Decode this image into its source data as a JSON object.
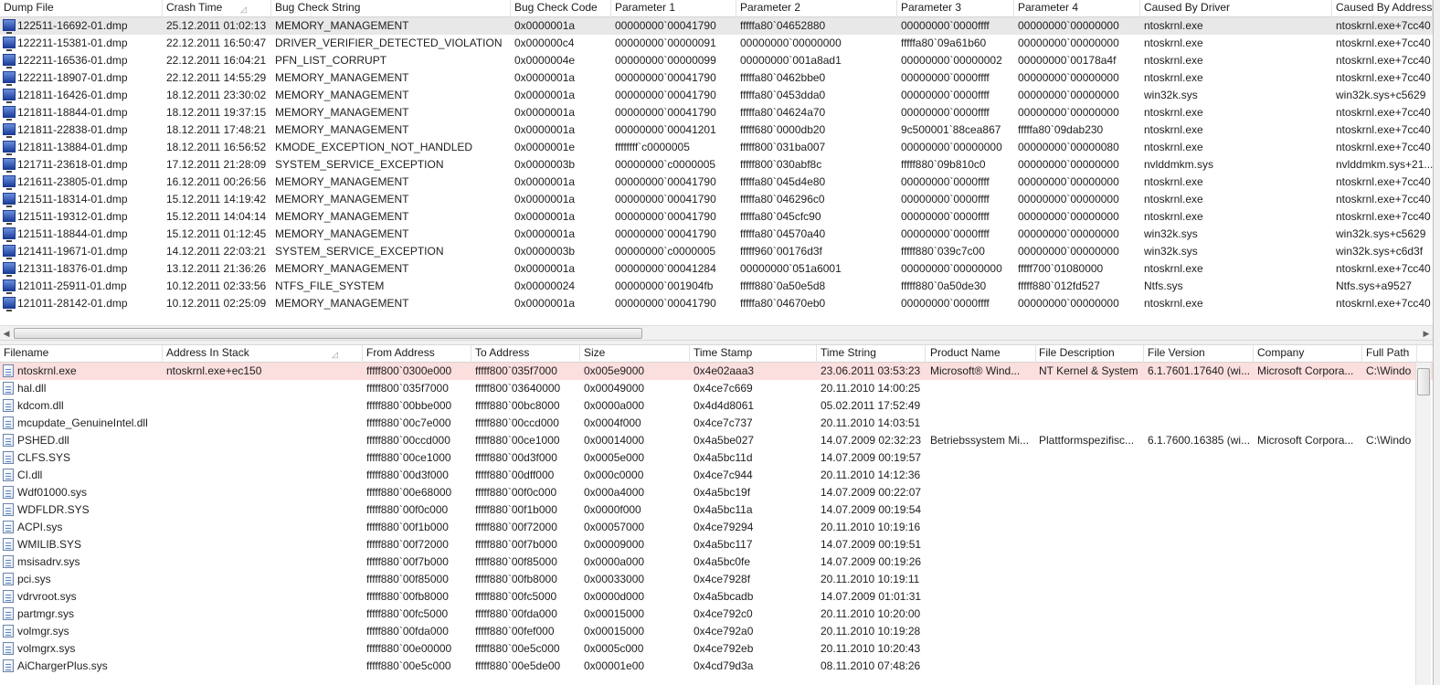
{
  "top_table": {
    "columns": [
      {
        "label": "Dump File"
      },
      {
        "label": "Crash Time",
        "sorted": true
      },
      {
        "label": "Bug Check String"
      },
      {
        "label": "Bug Check Code"
      },
      {
        "label": "Parameter 1"
      },
      {
        "label": "Parameter 2"
      },
      {
        "label": "Parameter 3"
      },
      {
        "label": "Parameter 4"
      },
      {
        "label": "Caused By Driver"
      },
      {
        "label": "Caused By Address"
      }
    ],
    "rows": [
      [
        "122511-16692-01.dmp",
        "25.12.2011 01:02:13",
        "MEMORY_MANAGEMENT",
        "0x0000001a",
        "00000000`00041790",
        "fffffa80`04652880",
        "00000000`0000ffff",
        "00000000`00000000",
        "ntoskrnl.exe",
        "ntoskrnl.exe+7cc40"
      ],
      [
        "122211-15381-01.dmp",
        "22.12.2011 16:50:47",
        "DRIVER_VERIFIER_DETECTED_VIOLATION",
        "0x000000c4",
        "00000000`00000091",
        "00000000`00000000",
        "fffffa80`09a61b60",
        "00000000`00000000",
        "ntoskrnl.exe",
        "ntoskrnl.exe+7cc40"
      ],
      [
        "122211-16536-01.dmp",
        "22.12.2011 16:04:21",
        "PFN_LIST_CORRUPT",
        "0x0000004e",
        "00000000`00000099",
        "00000000`001a8ad1",
        "00000000`00000002",
        "00000000`00178a4f",
        "ntoskrnl.exe",
        "ntoskrnl.exe+7cc40"
      ],
      [
        "122211-18907-01.dmp",
        "22.12.2011 14:55:29",
        "MEMORY_MANAGEMENT",
        "0x0000001a",
        "00000000`00041790",
        "fffffa80`0462bbe0",
        "00000000`0000ffff",
        "00000000`00000000",
        "ntoskrnl.exe",
        "ntoskrnl.exe+7cc40"
      ],
      [
        "121811-16426-01.dmp",
        "18.12.2011 23:30:02",
        "MEMORY_MANAGEMENT",
        "0x0000001a",
        "00000000`00041790",
        "fffffa80`0453dda0",
        "00000000`0000ffff",
        "00000000`00000000",
        "win32k.sys",
        "win32k.sys+c5629"
      ],
      [
        "121811-18844-01.dmp",
        "18.12.2011 19:37:15",
        "MEMORY_MANAGEMENT",
        "0x0000001a",
        "00000000`00041790",
        "fffffa80`04624a70",
        "00000000`0000ffff",
        "00000000`00000000",
        "ntoskrnl.exe",
        "ntoskrnl.exe+7cc40"
      ],
      [
        "121811-22838-01.dmp",
        "18.12.2011 17:48:21",
        "MEMORY_MANAGEMENT",
        "0x0000001a",
        "00000000`00041201",
        "fffff680`0000db20",
        "9c500001`88cea867",
        "fffffa80`09dab230",
        "ntoskrnl.exe",
        "ntoskrnl.exe+7cc40"
      ],
      [
        "121811-13884-01.dmp",
        "18.12.2011 16:56:52",
        "KMODE_EXCEPTION_NOT_HANDLED",
        "0x0000001e",
        "ffffffff`c0000005",
        "fffff800`031ba007",
        "00000000`00000000",
        "00000000`00000080",
        "ntoskrnl.exe",
        "ntoskrnl.exe+7cc40"
      ],
      [
        "121711-23618-01.dmp",
        "17.12.2011 21:28:09",
        "SYSTEM_SERVICE_EXCEPTION",
        "0x0000003b",
        "00000000`c0000005",
        "fffff800`030abf8c",
        "fffff880`09b810c0",
        "00000000`00000000",
        "nvlddmkm.sys",
        "nvlddmkm.sys+21..."
      ],
      [
        "121611-23805-01.dmp",
        "16.12.2011 00:26:56",
        "MEMORY_MANAGEMENT",
        "0x0000001a",
        "00000000`00041790",
        "fffffa80`045d4e80",
        "00000000`0000ffff",
        "00000000`00000000",
        "ntoskrnl.exe",
        "ntoskrnl.exe+7cc40"
      ],
      [
        "121511-18314-01.dmp",
        "15.12.2011 14:19:42",
        "MEMORY_MANAGEMENT",
        "0x0000001a",
        "00000000`00041790",
        "fffffa80`046296c0",
        "00000000`0000ffff",
        "00000000`00000000",
        "ntoskrnl.exe",
        "ntoskrnl.exe+7cc40"
      ],
      [
        "121511-19312-01.dmp",
        "15.12.2011 14:04:14",
        "MEMORY_MANAGEMENT",
        "0x0000001a",
        "00000000`00041790",
        "fffffa80`045cfc90",
        "00000000`0000ffff",
        "00000000`00000000",
        "ntoskrnl.exe",
        "ntoskrnl.exe+7cc40"
      ],
      [
        "121511-18844-01.dmp",
        "15.12.2011 01:12:45",
        "MEMORY_MANAGEMENT",
        "0x0000001a",
        "00000000`00041790",
        "fffffa80`04570a40",
        "00000000`0000ffff",
        "00000000`00000000",
        "win32k.sys",
        "win32k.sys+c5629"
      ],
      [
        "121411-19671-01.dmp",
        "14.12.2011 22:03:21",
        "SYSTEM_SERVICE_EXCEPTION",
        "0x0000003b",
        "00000000`c0000005",
        "fffff960`00176d3f",
        "fffff880`039c7c00",
        "00000000`00000000",
        "win32k.sys",
        "win32k.sys+c6d3f"
      ],
      [
        "121311-18376-01.dmp",
        "13.12.2011 21:36:26",
        "MEMORY_MANAGEMENT",
        "0x0000001a",
        "00000000`00041284",
        "00000000`051a6001",
        "00000000`00000000",
        "fffff700`01080000",
        "ntoskrnl.exe",
        "ntoskrnl.exe+7cc40"
      ],
      [
        "121011-25911-01.dmp",
        "10.12.2011 02:33:56",
        "NTFS_FILE_SYSTEM",
        "0x00000024",
        "00000000`001904fb",
        "fffff880`0a50e5d8",
        "fffff880`0a50de30",
        "fffff880`012fd527",
        "Ntfs.sys",
        "Ntfs.sys+a9527"
      ],
      [
        "121011-28142-01.dmp",
        "10.12.2011 02:25:09",
        "MEMORY_MANAGEMENT",
        "0x0000001a",
        "00000000`00041790",
        "fffffa80`04670eb0",
        "00000000`0000ffff",
        "00000000`00000000",
        "ntoskrnl.exe",
        "ntoskrnl.exe+7cc40"
      ]
    ],
    "selected_row": 0,
    "selected_color": "#e8e8e8"
  },
  "bottom_table": {
    "columns": [
      {
        "label": "Filename"
      },
      {
        "label": "Address In Stack",
        "sorted": true
      },
      {
        "label": "From Address"
      },
      {
        "label": "To Address"
      },
      {
        "label": "Size"
      },
      {
        "label": "Time Stamp"
      },
      {
        "label": "Time String"
      },
      {
        "label": "Product Name"
      },
      {
        "label": "File Description"
      },
      {
        "label": "File Version"
      },
      {
        "label": "Company"
      },
      {
        "label": "Full Path"
      }
    ],
    "rows": [
      [
        "ntoskrnl.exe",
        "ntoskrnl.exe+ec150",
        "fffff800`0300e000",
        "fffff800`035f7000",
        "0x005e9000",
        "0x4e02aaa3",
        "23.06.2011 03:53:23",
        "Microsoft® Wind...",
        "NT Kernel & System",
        "6.1.7601.17640 (wi...",
        "Microsoft Corpora...",
        "C:\\Windo"
      ],
      [
        "hal.dll",
        "",
        "fffff800`035f7000",
        "fffff800`03640000",
        "0x00049000",
        "0x4ce7c669",
        "20.11.2010 14:00:25",
        "",
        "",
        "",
        "",
        ""
      ],
      [
        "kdcom.dll",
        "",
        "fffff880`00bbe000",
        "fffff880`00bc8000",
        "0x0000a000",
        "0x4d4d8061",
        "05.02.2011 17:52:49",
        "",
        "",
        "",
        "",
        ""
      ],
      [
        "mcupdate_GenuineIntel.dll",
        "",
        "fffff880`00c7e000",
        "fffff880`00ccd000",
        "0x0004f000",
        "0x4ce7c737",
        "20.11.2010 14:03:51",
        "",
        "",
        "",
        "",
        ""
      ],
      [
        "PSHED.dll",
        "",
        "fffff880`00ccd000",
        "fffff880`00ce1000",
        "0x00014000",
        "0x4a5be027",
        "14.07.2009 02:32:23",
        "Betriebssystem Mi...",
        "Plattformspezifisc...",
        "6.1.7600.16385 (wi...",
        "Microsoft Corpora...",
        "C:\\Windo"
      ],
      [
        "CLFS.SYS",
        "",
        "fffff880`00ce1000",
        "fffff880`00d3f000",
        "0x0005e000",
        "0x4a5bc11d",
        "14.07.2009 00:19:57",
        "",
        "",
        "",
        "",
        ""
      ],
      [
        "CI.dll",
        "",
        "fffff880`00d3f000",
        "fffff880`00dff000",
        "0x000c0000",
        "0x4ce7c944",
        "20.11.2010 14:12:36",
        "",
        "",
        "",
        "",
        ""
      ],
      [
        "Wdf01000.sys",
        "",
        "fffff880`00e68000",
        "fffff880`00f0c000",
        "0x000a4000",
        "0x4a5bc19f",
        "14.07.2009 00:22:07",
        "",
        "",
        "",
        "",
        ""
      ],
      [
        "WDFLDR.SYS",
        "",
        "fffff880`00f0c000",
        "fffff880`00f1b000",
        "0x0000f000",
        "0x4a5bc11a",
        "14.07.2009 00:19:54",
        "",
        "",
        "",
        "",
        ""
      ],
      [
        "ACPI.sys",
        "",
        "fffff880`00f1b000",
        "fffff880`00f72000",
        "0x00057000",
        "0x4ce79294",
        "20.11.2010 10:19:16",
        "",
        "",
        "",
        "",
        ""
      ],
      [
        "WMILIB.SYS",
        "",
        "fffff880`00f72000",
        "fffff880`00f7b000",
        "0x00009000",
        "0x4a5bc117",
        "14.07.2009 00:19:51",
        "",
        "",
        "",
        "",
        ""
      ],
      [
        "msisadrv.sys",
        "",
        "fffff880`00f7b000",
        "fffff880`00f85000",
        "0x0000a000",
        "0x4a5bc0fe",
        "14.07.2009 00:19:26",
        "",
        "",
        "",
        "",
        ""
      ],
      [
        "pci.sys",
        "",
        "fffff880`00f85000",
        "fffff880`00fb8000",
        "0x00033000",
        "0x4ce7928f",
        "20.11.2010 10:19:11",
        "",
        "",
        "",
        "",
        ""
      ],
      [
        "vdrvroot.sys",
        "",
        "fffff880`00fb8000",
        "fffff880`00fc5000",
        "0x0000d000",
        "0x4a5bcadb",
        "14.07.2009 01:01:31",
        "",
        "",
        "",
        "",
        ""
      ],
      [
        "partmgr.sys",
        "",
        "fffff880`00fc5000",
        "fffff880`00fda000",
        "0x00015000",
        "0x4ce792c0",
        "20.11.2010 10:20:00",
        "",
        "",
        "",
        "",
        ""
      ],
      [
        "volmgr.sys",
        "",
        "fffff880`00fda000",
        "fffff880`00fef000",
        "0x00015000",
        "0x4ce792a0",
        "20.11.2010 10:19:28",
        "",
        "",
        "",
        "",
        ""
      ],
      [
        "volmgrx.sys",
        "",
        "fffff880`00e00000",
        "fffff880`00e5c000",
        "0x0005c000",
        "0x4ce792eb",
        "20.11.2010 10:20:43",
        "",
        "",
        "",
        "",
        ""
      ],
      [
        "AiChargerPlus.sys",
        "",
        "fffff880`00e5c000",
        "fffff880`00e5de00",
        "0x00001e00",
        "0x4cd79d3a",
        "08.11.2010 07:48:26",
        "",
        "",
        "",
        "",
        ""
      ]
    ],
    "highlight_row": 0,
    "highlight_color": "#fbdede"
  },
  "scroll_arrows": {
    "left": "◀",
    "right": "▶",
    "up": "▲"
  }
}
